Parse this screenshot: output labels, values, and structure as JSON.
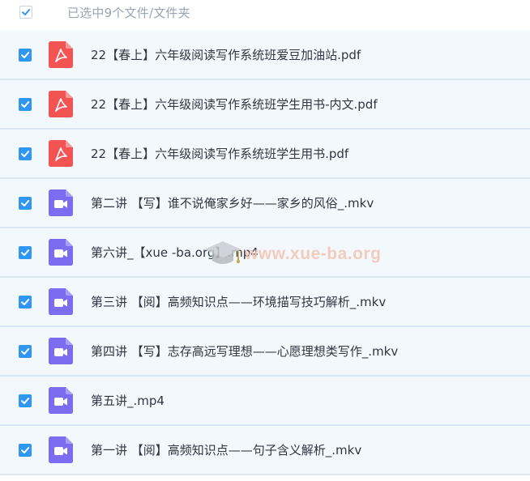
{
  "header": {
    "selection_label": "已选中9个文件/文件夹"
  },
  "files": [
    {
      "name": "22【春上】六年级阅读写作系统班爱豆加油站.pdf",
      "icon": "pdf-icon"
    },
    {
      "name": "22【春上】六年级阅读写作系统班学生用书-内文.pdf",
      "icon": "pdf-icon"
    },
    {
      "name": "22【春上】六年级阅读写作系统班学生用书.pdf",
      "icon": "pdf-icon"
    },
    {
      "name": "第二讲 【写】谁不说俺家乡好——家乡的风俗_.mkv",
      "icon": "video-icon"
    },
    {
      "name": "第六讲_【xue -ba.org】.mp4",
      "icon": "video-icon"
    },
    {
      "name": "第三讲 【阅】高频知识点——环境描写技巧解析_.mkv",
      "icon": "video-icon"
    },
    {
      "name": "第四讲 【写】志存高远写理想——心愿理想类写作_.mkv",
      "icon": "video-icon"
    },
    {
      "name": "第五讲_.mp4",
      "icon": "video-icon"
    },
    {
      "name": "第一讲 【阅】高频知识点——句子含义解析_.mkv",
      "icon": "video-icon"
    }
  ],
  "watermark": {
    "text": "www.xue-ba.org"
  },
  "colors": {
    "checkbox": "#2f96f4",
    "row_bg": "#f3f8fd",
    "pdf_icon": "#f25353",
    "video_icon": "#7b6cf0"
  }
}
